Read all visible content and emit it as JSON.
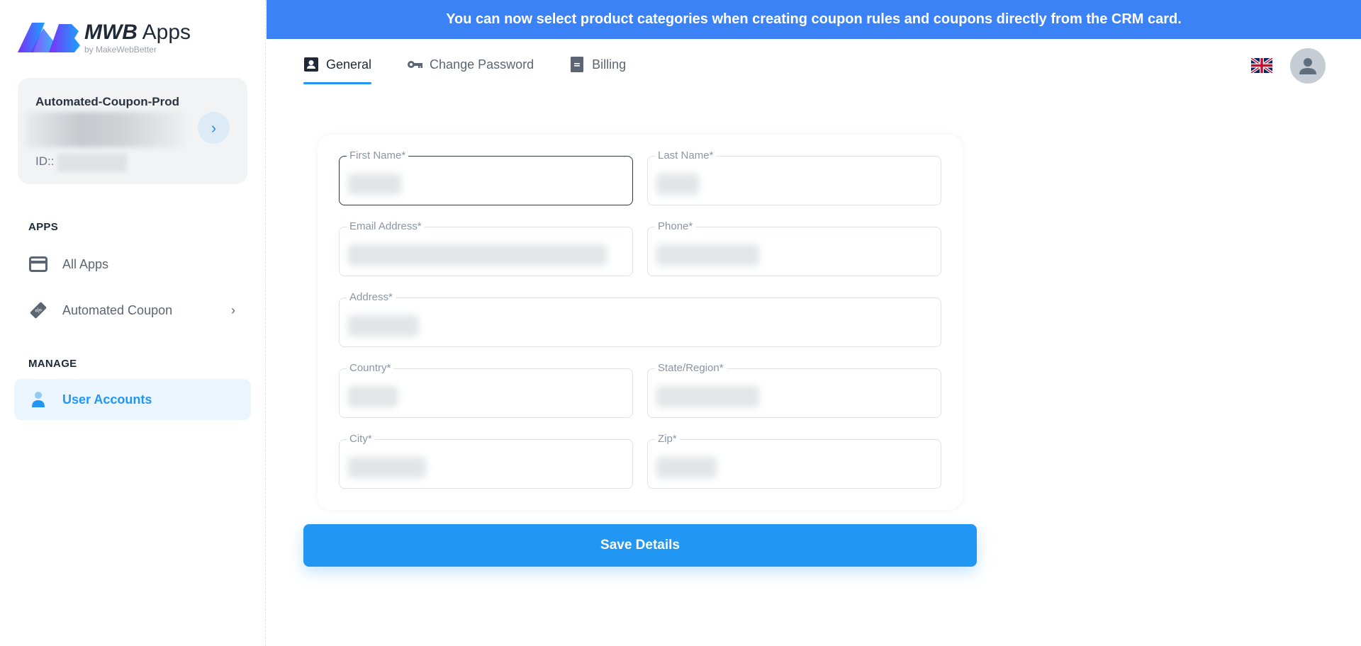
{
  "brand": {
    "title_bold": "MWB",
    "title_rest": " Apps",
    "subtitle": "by MakeWebBetter"
  },
  "account": {
    "name": "Automated-Coupon-Prod",
    "id_label": "ID::"
  },
  "sidebar": {
    "sections": [
      {
        "label": "APPS",
        "items": [
          {
            "label": "All Apps",
            "icon": "card-icon"
          },
          {
            "label": "Automated Coupon",
            "icon": "coupon-tag-icon",
            "has_submenu": true
          }
        ]
      },
      {
        "label": "MANAGE",
        "items": [
          {
            "label": "User Accounts",
            "icon": "user-icon",
            "active": true
          }
        ]
      }
    ]
  },
  "banner": {
    "text": "You can now select product categories when creating coupon rules and coupons directly from the CRM card."
  },
  "tabs": [
    {
      "label": "General",
      "icon": "contact-card-icon",
      "active": true
    },
    {
      "label": "Change Password",
      "icon": "key-icon"
    },
    {
      "label": "Billing",
      "icon": "document-icon"
    }
  ],
  "header": {
    "language": "English (UK)"
  },
  "form": {
    "fields": {
      "first_name": {
        "label": "First Name*",
        "value": ""
      },
      "last_name": {
        "label": "Last Name*",
        "value": ""
      },
      "email": {
        "label": "Email Address*",
        "value": ""
      },
      "phone": {
        "label": "Phone*",
        "value": ""
      },
      "address": {
        "label": "Address*",
        "value": ""
      },
      "country": {
        "label": "Country*",
        "value": ""
      },
      "state": {
        "label": "State/Region*",
        "value": ""
      },
      "city": {
        "label": "City*",
        "value": ""
      },
      "zip": {
        "label": "Zip*",
        "value": ""
      }
    },
    "save_label": "Save Details"
  },
  "colors": {
    "accent": "#2196f3",
    "banner": "#3b82f6",
    "active_nav_bg": "#ebf5fd"
  }
}
